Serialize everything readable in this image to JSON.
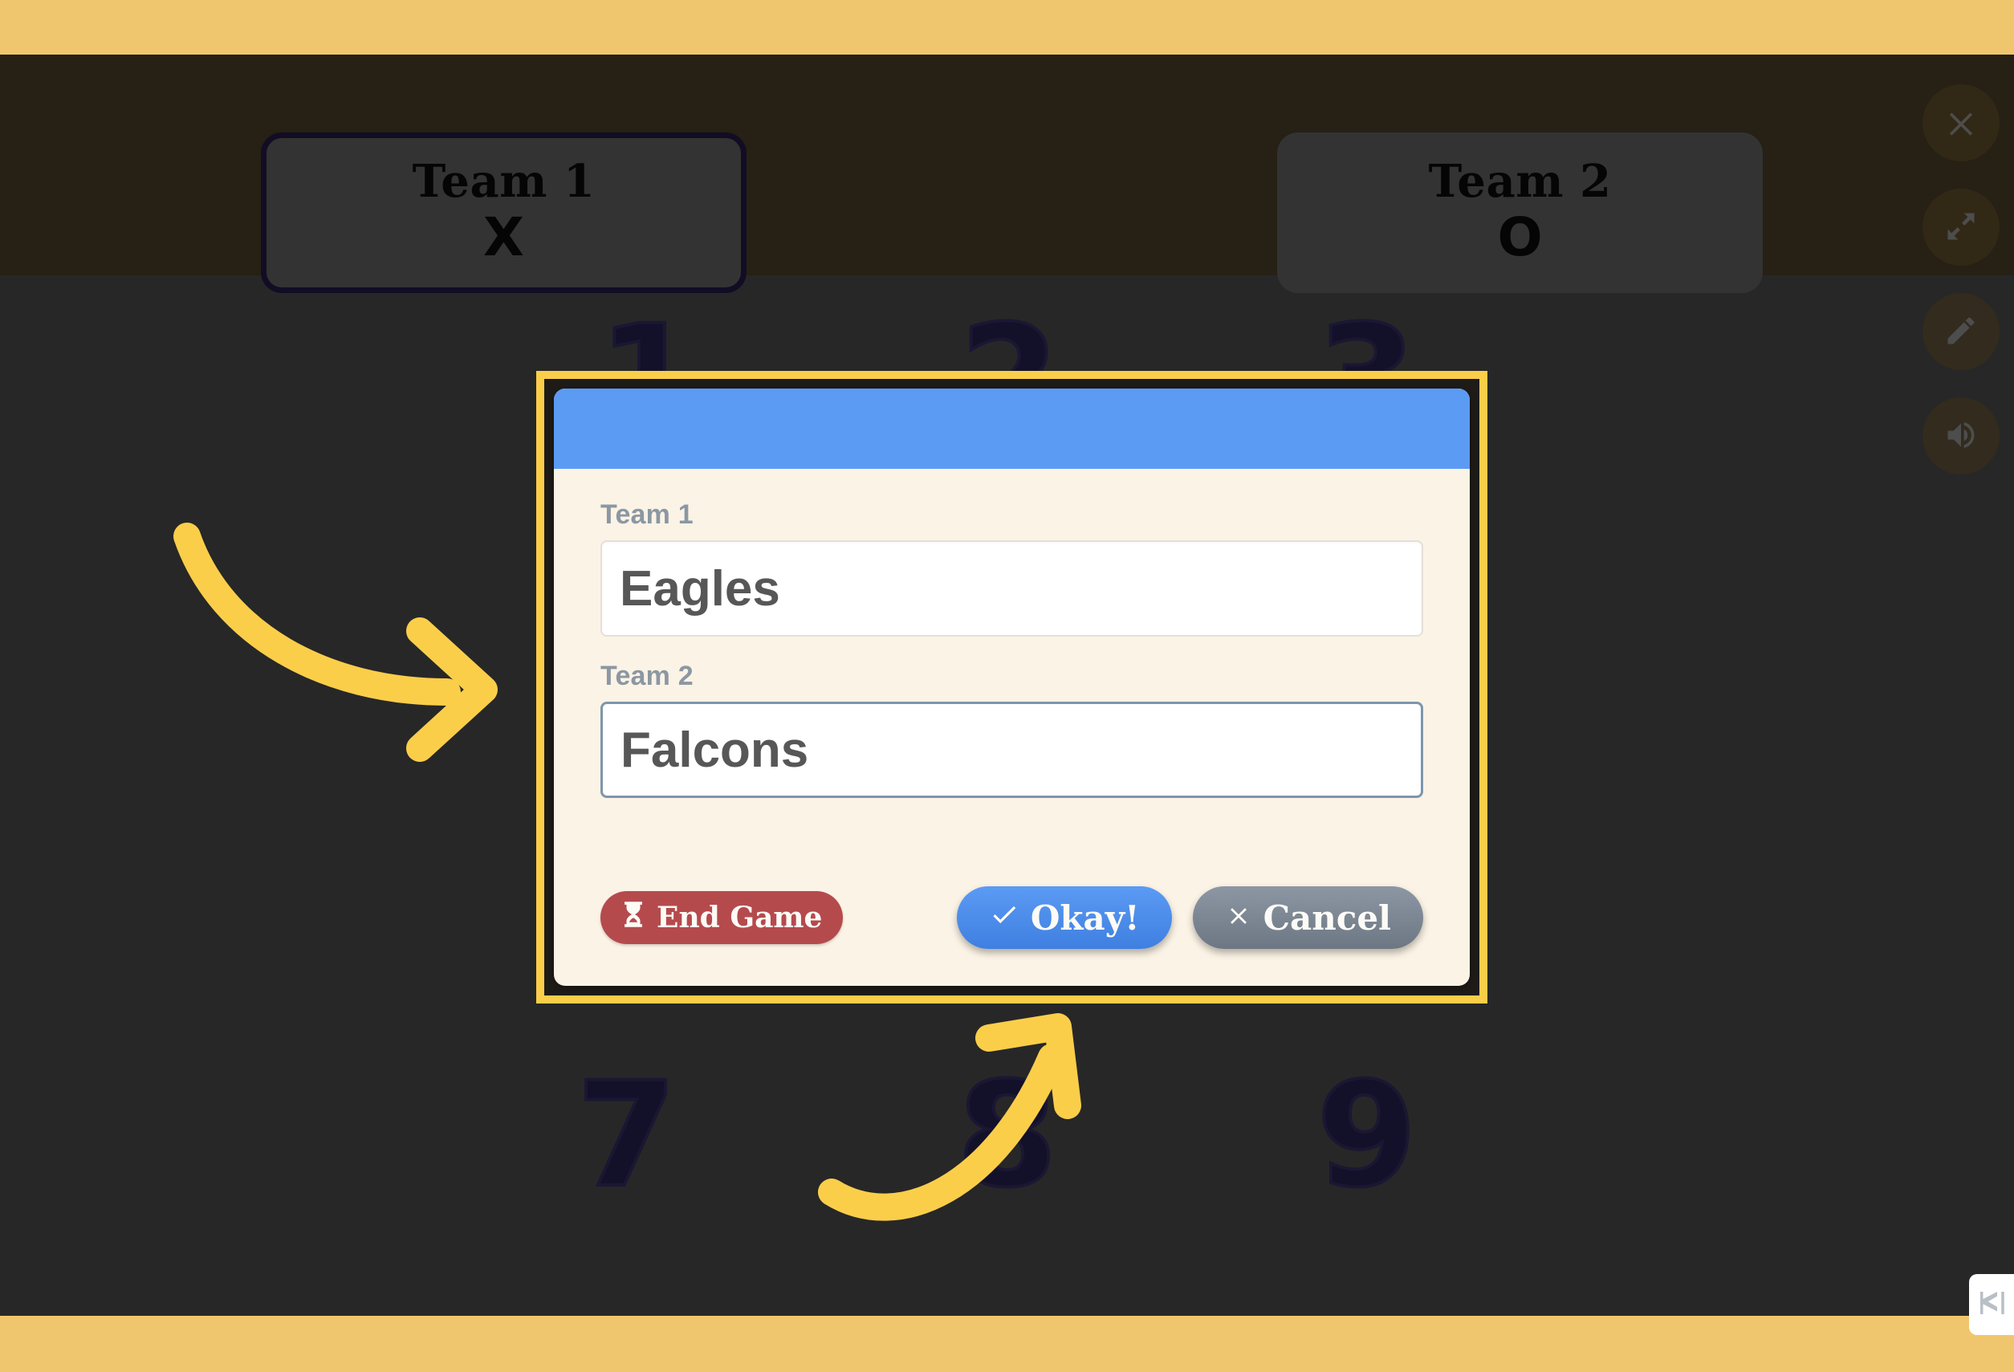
{
  "app": {
    "background_color": "#272727",
    "accent_bar_color": "#efc66d",
    "header_band_color": "#262015",
    "highlight_color": "#fbce4a"
  },
  "header": {
    "teams": [
      {
        "name": "Team 1",
        "mark": "X",
        "active": true
      },
      {
        "name": "Team 2",
        "mark": "O",
        "active": false
      }
    ]
  },
  "icon_rail": {
    "buttons": [
      {
        "icon": "close-icon",
        "label": "Close"
      },
      {
        "icon": "fullscreen-icon",
        "label": "Fullscreen"
      },
      {
        "icon": "pencil-icon",
        "label": "Edit"
      },
      {
        "icon": "volume-icon",
        "label": "Sound"
      }
    ]
  },
  "board": {
    "numbers": [
      "1",
      "2",
      "3",
      "7",
      "8",
      "9"
    ]
  },
  "annotations": {
    "arrow_color": "#fbce4a",
    "arrows": [
      {
        "name": "arrow-to-fields",
        "direction": "right"
      },
      {
        "name": "arrow-to-okay",
        "direction": "up-right"
      }
    ]
  },
  "modal": {
    "titlebar_color": "#5b9bf4",
    "body_color": "#fbf3e5",
    "fields": [
      {
        "label": "Team 1",
        "value": "Eagles",
        "placeholder": "Team 1",
        "focused": false
      },
      {
        "label": "Team 2",
        "value": "Falcons",
        "placeholder": "Team 2",
        "focused": true
      }
    ],
    "buttons": {
      "end_game": {
        "label": "End Game",
        "icon": "hourglass-icon",
        "color": "#b54a4d"
      },
      "okay": {
        "label": "Okay!",
        "icon": "check-icon",
        "color": "#4a87e8"
      },
      "cancel": {
        "label": "Cancel",
        "icon": "x-icon",
        "color": "#7d8793"
      }
    }
  },
  "brand": {
    "icon": "h5p-logo-icon"
  }
}
